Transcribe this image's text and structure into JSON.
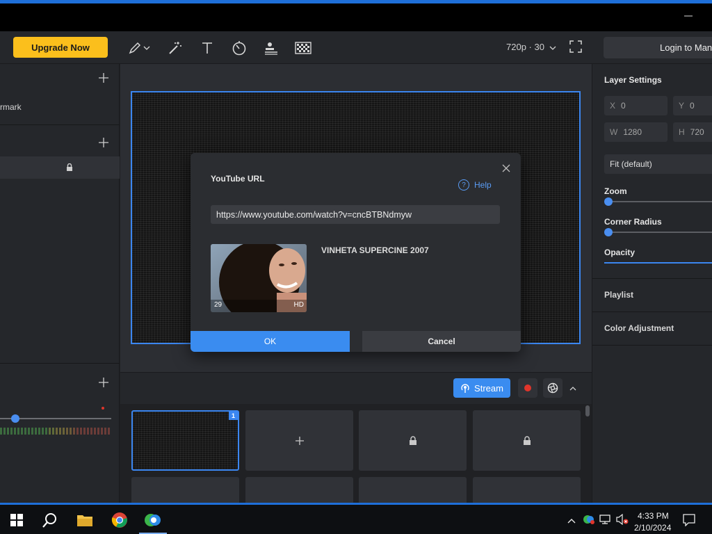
{
  "toolbar": {
    "upgrade_label": "Upgrade Now",
    "resolution": "720p · 30",
    "login_label": "Login to Manycam"
  },
  "left_panel": {
    "watermark_label": "rmark"
  },
  "dialog": {
    "title": "YouTube URL",
    "help_label": "Help",
    "url_value": "https://www.youtube.com/watch?v=cncBTBNdmyw",
    "video_title": "VINHETA SUPERCINE 2007",
    "thumb_count": "29",
    "thumb_quality": "HD",
    "ok_label": "OK",
    "cancel_label": "Cancel"
  },
  "streambar": {
    "stream_label": "Stream"
  },
  "scenes": {
    "active_badge": "1"
  },
  "right_panel": {
    "title": "Layer Settings",
    "x_label": "X",
    "x_value": "0",
    "y_label": "Y",
    "y_value": "0",
    "w_label": "W",
    "w_value": "1280",
    "h_label": "H",
    "h_value": "720",
    "fit_value": "Fit (default)",
    "zoom_label": "Zoom",
    "corner_radius_label": "Corner Radius",
    "opacity_label": "Opacity",
    "playlist_label": "Playlist",
    "color_adjustment_label": "Color Adjustment"
  },
  "taskbar": {
    "time": "4:33 PM",
    "date": "2/10/2024"
  },
  "colors": {
    "accent": "#3a8cf0",
    "upgrade": "#fbbf1c",
    "record": "#e0352b"
  }
}
